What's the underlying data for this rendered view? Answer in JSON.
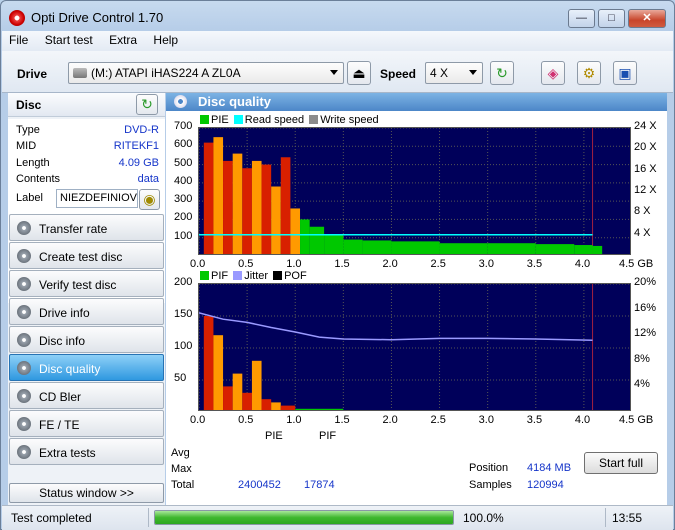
{
  "window": {
    "title": "Opti Drive Control 1.70"
  },
  "menu": [
    "File",
    "Start test",
    "Extra",
    "Help"
  ],
  "toolbar": {
    "drive_label": "Drive",
    "drive_value": "(M:)   ATAPI iHAS224   A ZL0A",
    "speed_label": "Speed",
    "speed_value": "4 X"
  },
  "disc": {
    "title": "Disc",
    "rows": [
      {
        "key": "Type",
        "value": "DVD-R"
      },
      {
        "key": "MID",
        "value": "RITEKF1"
      },
      {
        "key": "Length",
        "value": "4.09 GB"
      },
      {
        "key": "Contents",
        "value": "data"
      }
    ],
    "label_key": "Label",
    "label_value": "NIEZDEFINIOV"
  },
  "nav": [
    {
      "label": "Transfer rate",
      "active": false
    },
    {
      "label": "Create test disc",
      "active": false
    },
    {
      "label": "Verify test disc",
      "active": false
    },
    {
      "label": "Drive info",
      "active": false
    },
    {
      "label": "Disc info",
      "active": false
    },
    {
      "label": "Disc quality",
      "active": true
    },
    {
      "label": "CD Bler",
      "active": false
    },
    {
      "label": "FE / TE",
      "active": false
    },
    {
      "label": "Extra tests",
      "active": false
    }
  ],
  "status_window": "Status window >>",
  "panel": {
    "title": "Disc quality"
  },
  "chart_data": [
    {
      "type": "bar",
      "legend": [
        "PIE",
        "Read speed",
        "Write speed"
      ],
      "colors": {
        "PIE": "#00c800",
        "Read speed": "#00ffff",
        "Write speed": "#8c8c8c"
      },
      "x_ticks": [
        "0.0",
        "0.5",
        "1.0",
        "1.5",
        "2.0",
        "2.5",
        "3.0",
        "3.5",
        "4.0",
        "4.5 GB"
      ],
      "y_left_ticks": [
        "700",
        "600",
        "500",
        "400",
        "300",
        "200",
        "100"
      ],
      "y_right_ticks": [
        "24 X",
        "20 X",
        "16 X",
        "12 X",
        "8 X",
        "4 X"
      ],
      "xlim": [
        0,
        4.5
      ],
      "ylim": [
        0,
        700
      ],
      "y2lim": [
        0,
        24
      ],
      "series": [
        {
          "name": "PIE",
          "x": [
            0.05,
            0.15,
            0.25,
            0.35,
            0.45,
            0.55,
            0.65,
            0.75,
            0.85,
            0.95,
            1.05,
            1.15,
            1.3,
            1.5,
            1.7,
            2.0,
            2.5,
            3.0,
            3.5,
            3.9,
            4.09
          ],
          "values": [
            620,
            650,
            520,
            560,
            480,
            520,
            500,
            380,
            540,
            260,
            200,
            160,
            120,
            90,
            85,
            80,
            70,
            70,
            65,
            60,
            55
          ]
        },
        {
          "name": "Read speed",
          "x": [
            0.0,
            4.09
          ],
          "values": [
            4,
            4
          ]
        }
      ]
    },
    {
      "type": "bar",
      "legend": [
        "PIF",
        "Jitter",
        "POF"
      ],
      "colors": {
        "PIF": "#00c800",
        "Jitter": "#9a9aff",
        "POF": "#000000"
      },
      "x_ticks": [
        "0.0",
        "0.5",
        "1.0",
        "1.5",
        "2.0",
        "2.5",
        "3.0",
        "3.5",
        "4.0",
        "4.5 GB"
      ],
      "y_left_ticks": [
        "200",
        "150",
        "100",
        "50"
      ],
      "y_right_ticks": [
        "20%",
        "16%",
        "12%",
        "8%",
        "4%"
      ],
      "xlim": [
        0,
        4.5
      ],
      "ylim": [
        0,
        200
      ],
      "y2lim": [
        0,
        20
      ],
      "series": [
        {
          "name": "PIF",
          "x": [
            0.05,
            0.15,
            0.25,
            0.35,
            0.45,
            0.55,
            0.65,
            0.75,
            0.85,
            1.0,
            1.5,
            2.0,
            3.0,
            4.0
          ],
          "values": [
            150,
            120,
            40,
            60,
            30,
            80,
            20,
            15,
            10,
            5,
            3,
            2,
            2,
            1
          ]
        },
        {
          "name": "Jitter",
          "x": [
            0.0,
            0.25,
            0.5,
            0.75,
            1.0,
            1.25,
            1.5,
            2.0,
            2.5,
            3.0,
            3.5,
            4.09
          ],
          "values": [
            15.5,
            14.5,
            14.0,
            13.2,
            12.5,
            11.7,
            11.4,
            11.3,
            11.5,
            11.5,
            11.4,
            11.2
          ]
        }
      ]
    }
  ],
  "stats": {
    "col_pie": "PIE",
    "col_pif": "PIF",
    "avg_label": "Avg",
    "max_label": "Max",
    "total_label": "Total",
    "total_pie": "2400452",
    "total_pif": "17874",
    "position_label": "Position",
    "position_value": "4184 MB",
    "samples_label": "Samples",
    "samples_value": "120994",
    "start_button": "Start full"
  },
  "status": {
    "message": "Test completed",
    "progress": 1.0,
    "percent": "100.0%",
    "time": "13:55"
  }
}
